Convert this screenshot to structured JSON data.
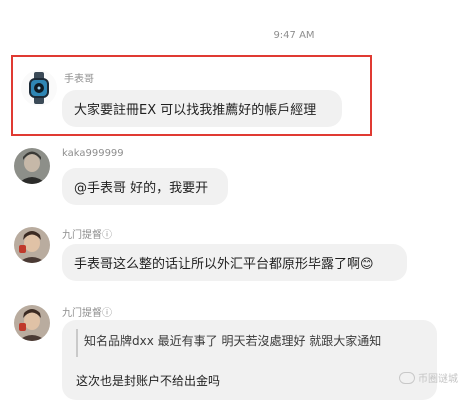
{
  "timestamp": "9:47 AM",
  "messages": [
    {
      "sender": "手表哥",
      "text": "大家要註冊EX 可以找我推薦好的帳戶經理"
    },
    {
      "sender": "kaka999999",
      "text": "@手表哥 好的，我要开"
    },
    {
      "sender": "九门提督ⓘ",
      "text": "手表哥这么整的话让所以外汇平台都原形毕露了啊😊"
    },
    {
      "sender": "九门提督ⓘ",
      "quote": "知名品牌dxx 最近有事了 明天若沒處理好 就跟大家通知",
      "text": "这次也是封账户不给出金吗"
    }
  ],
  "watermark": "币圈谜城",
  "colors": {
    "highlight": "#e03a32",
    "bubble": "#f1f1f1",
    "meta_text": "#8e8e8e"
  }
}
